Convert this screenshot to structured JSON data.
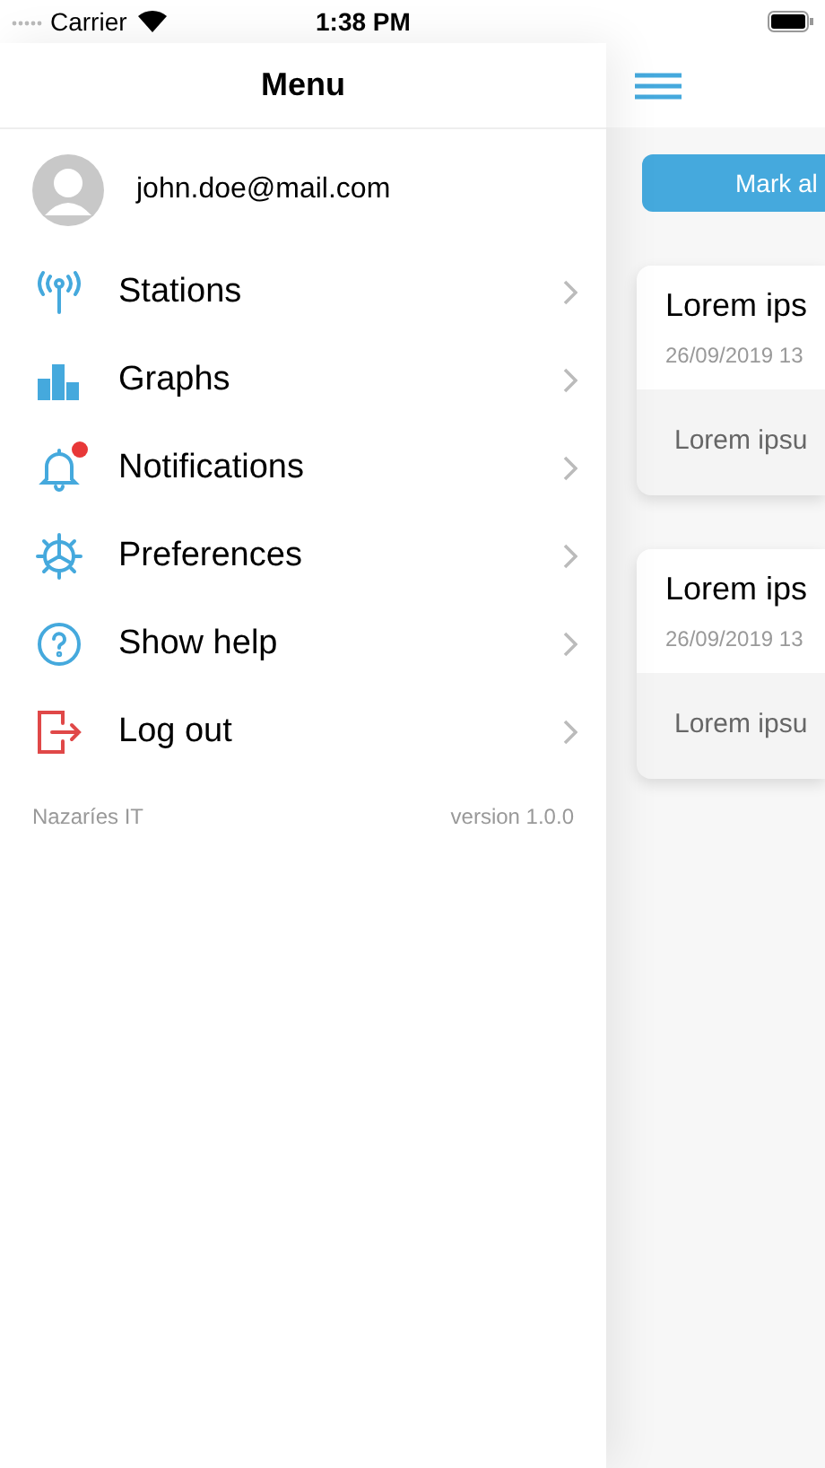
{
  "status_bar": {
    "carrier": "Carrier",
    "time": "1:38 PM"
  },
  "menu": {
    "title": "Menu",
    "user": {
      "email": "john.doe@mail.com"
    },
    "items": [
      {
        "label": "Stations",
        "badge": false
      },
      {
        "label": "Graphs",
        "badge": false
      },
      {
        "label": "Notifications",
        "badge": true
      },
      {
        "label": "Preferences",
        "badge": false
      },
      {
        "label": "Show help",
        "badge": false
      },
      {
        "label": "Log out",
        "badge": false
      }
    ],
    "footer": {
      "company": "Nazaríes IT",
      "version": "version 1.0.0"
    }
  },
  "content": {
    "mark_button": "Mark al",
    "cards": [
      {
        "title": "Lorem ips",
        "date": "26/09/2019 13",
        "body": "Lorem ipsu"
      },
      {
        "title": "Lorem ips",
        "date": "26/09/2019 13",
        "body": "Lorem ipsu"
      }
    ]
  }
}
